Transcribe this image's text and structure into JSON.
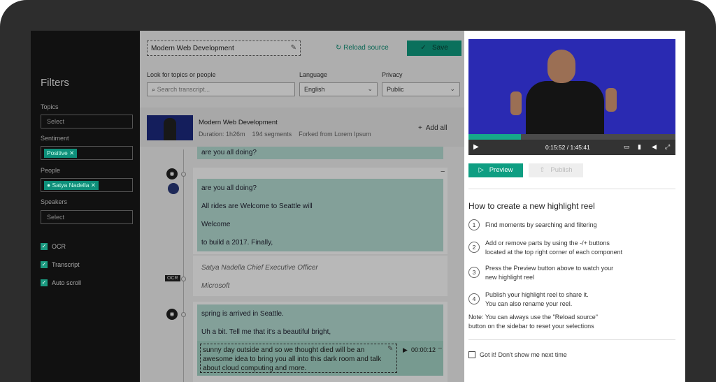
{
  "filters": {
    "title": "Filters",
    "topics_label": "Topics",
    "topics_placeholder": "Select",
    "sentiment_label": "Sentiment",
    "sentiment_tag": "Positive",
    "people_label": "People",
    "people_tag": "Satya Nadella",
    "speakers_label": "Speakers",
    "speakers_placeholder": "Select",
    "checks": [
      "OCR",
      "Transcript",
      "Auto scroll"
    ]
  },
  "editor": {
    "reel_name": "Modern Web Development",
    "reload_label": "Reload source",
    "save_label": "Save",
    "search_label": "Look for topics or people",
    "search_placeholder": "Search transcript...",
    "language_label": "Language",
    "language_value": "English",
    "privacy_label": "Privacy",
    "privacy_value": "Public",
    "source": {
      "title": "Modern Web Development",
      "duration": "Duration: 1h26m",
      "segments": "194 segments",
      "forked": "Forked from Lorem Ipsum",
      "add_all": "Add all"
    },
    "top_line": "are you all doing?",
    "block1": [
      "are you all doing?",
      "All rides are Welcome to Seattle will",
      "Welcome",
      "to build a 2017. Finally,"
    ],
    "ocr_badge": "OCR",
    "ocr_lines": [
      "Satya Nadella Chief Executive Officer",
      "Microsoft"
    ],
    "block2": [
      "spring is arrived in Seattle.",
      "Uh a bit. Tell me that it's a beautiful bright,"
    ],
    "edit_text": "sunny day outside and so we thought died will be an awesome idea to bring you all into this dark room and talk about cloud computing and more.",
    "edit_time": "00:00:12"
  },
  "player": {
    "time": "0:15:52 / 1:45:41",
    "progress": 0.253,
    "preview_label": "Preview",
    "publish_label": "Publish"
  },
  "help": {
    "title": "How to create a new highlight reel",
    "steps": [
      {
        "num": "1",
        "text": "Find moments by searching and filtering"
      },
      {
        "num": "2",
        "text": "Add or remove parts by using the -/+ buttons\nlocated at the top right corner of each component"
      },
      {
        "num": "3",
        "text": "Press the Preview button above to watch your\nnew highlight reel"
      },
      {
        "num": "4",
        "text": "Publish your highlight reel to share it.\nYou can also rename your reel."
      }
    ],
    "note": "Note: You can always use the \"Reload source\"\nbutton on the sidebar to reset your selections",
    "gotit": "Got it! Don't show me next time"
  },
  "colors": {
    "accent": "#0f9c80",
    "highlight": "#b6ded4",
    "video_bg": "#2a2ab2"
  }
}
